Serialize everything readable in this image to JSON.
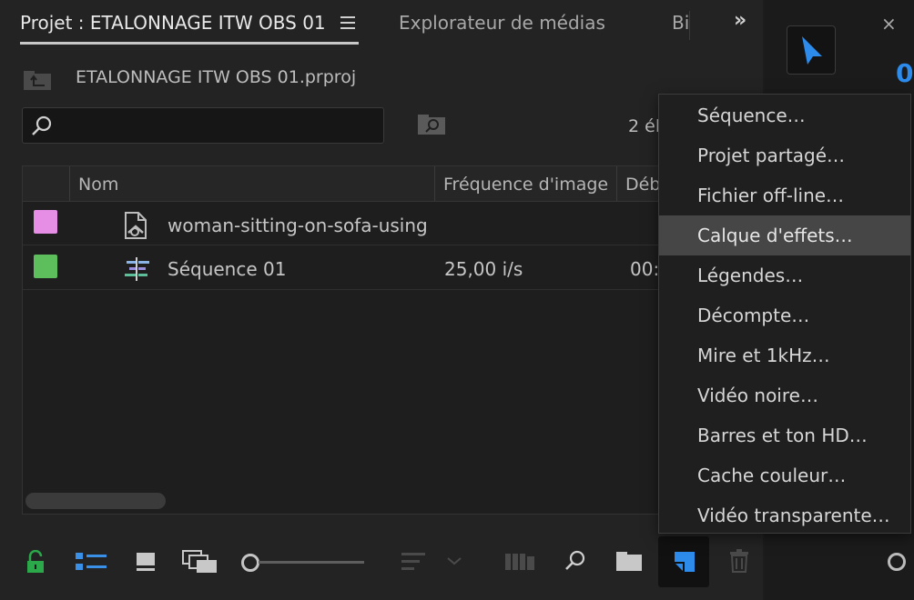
{
  "tabs": {
    "project": "Projet : ETALONNAGE ITW OBS 01",
    "media_browser": "Explorateur de médias",
    "partial": "Bi",
    "overflow": "»"
  },
  "project": {
    "file_name": "ETALONNAGE ITW OBS 01.prproj",
    "item_count": "2 él"
  },
  "search": {
    "placeholder": "",
    "value": ""
  },
  "table": {
    "columns": [
      "Nom",
      "Fréquence d'image",
      "Déb"
    ],
    "rows": [
      {
        "color": "#e68de5",
        "icon": "media-file-icon",
        "name": "woman-sitting-on-sofa-using",
        "frame_rate": "",
        "start": ""
      },
      {
        "color": "#5cbf5c",
        "icon": "sequence-icon",
        "name": "Séquence 01",
        "frame_rate": "25,00 i/s",
        "start": "00:"
      }
    ]
  },
  "context_menu": {
    "items": [
      "Séquence…",
      "Projet partagé…",
      "Fichier off-line…",
      "Calque d'effets…",
      "Légendes…",
      "Décompte…",
      "Mire et 1kHz…",
      "Vidéo noire…",
      "Barres et ton HD…",
      "Cache couleur…",
      "Vidéo transparente…"
    ],
    "highlighted_index": 3
  },
  "right_panel": {
    "close_label": "×",
    "value_partial": "0"
  },
  "colors": {
    "accent_blue": "#2d8ceb",
    "lock_green": "#2aa84a",
    "panel_bg": "#232323",
    "menu_highlight": "#464646"
  },
  "toolbar_icons": [
    "lock-icon",
    "list-view-icon",
    "icon-view-icon",
    "freeform-view-icon",
    "zoom-slider",
    "sort-icon",
    "automate-to-sequence-icon",
    "find-icon",
    "new-bin-icon",
    "new-item-icon",
    "clear-icon"
  ]
}
